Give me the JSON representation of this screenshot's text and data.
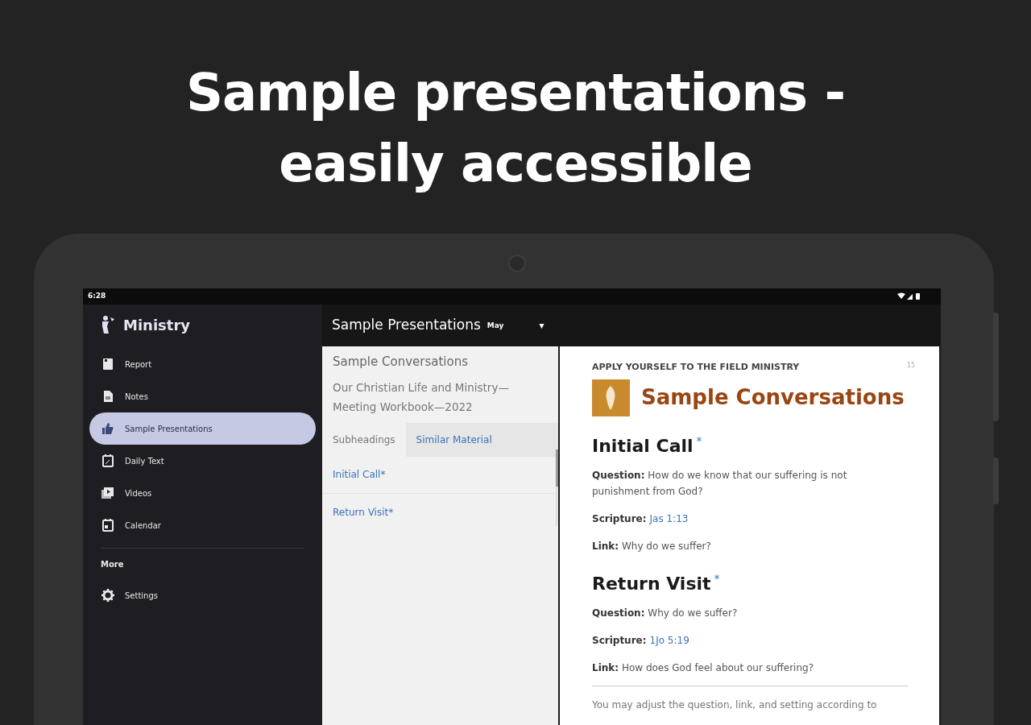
{
  "headline": [
    "Sample presentations -",
    "easily accessible"
  ],
  "status_bar": {
    "time": "6:28"
  },
  "sidebar": {
    "app_name": "Ministry",
    "items": [
      {
        "kind": "nav",
        "label": "Report",
        "selected": false
      },
      {
        "kind": "nav",
        "label": "Notes",
        "selected": false
      },
      {
        "kind": "nav",
        "label": "Sample Presentations",
        "selected": true
      },
      {
        "kind": "nav",
        "label": "Daily Text",
        "selected": false
      },
      {
        "kind": "nav",
        "label": "Videos",
        "selected": false
      },
      {
        "kind": "nav",
        "label": "Calendar",
        "selected": false
      },
      {
        "kind": "divider"
      },
      {
        "kind": "header",
        "label": "More"
      },
      {
        "kind": "nav",
        "label": "Settings",
        "selected": false
      }
    ]
  },
  "toolbar": {
    "title": "Sample Presentations",
    "month": "May",
    "dropdown": "▾"
  },
  "list_panel": {
    "title": "Sample Conversations",
    "source": [
      "Our Christian Life and Ministry—",
      "Meeting Workbook—2022"
    ],
    "tabs": [
      {
        "label": "Subheadings",
        "selected": true
      },
      {
        "label": "Similar Material",
        "selected": false
      }
    ],
    "items": [
      "Initial Call*",
      "Return Visit*"
    ]
  },
  "article": {
    "kicker": "APPLY YOURSELF TO THE FIELD MINISTRY",
    "page_number": "15",
    "title": "Sample Conversations",
    "sections": [
      {
        "heading": "Initial Call",
        "mark": "*",
        "fields": [
          {
            "label": "Question:",
            "value": "How do we know that our suffering is not punishment from God?",
            "kind": "text"
          },
          {
            "label": "Scripture:",
            "value": "Jas 1:13",
            "kind": "link"
          },
          {
            "label": "Link:",
            "value": "Why do we suffer?",
            "kind": "text"
          }
        ]
      },
      {
        "heading": "Return Visit",
        "mark": "*",
        "fields": [
          {
            "label": "Question:",
            "value": "Why do we suffer?",
            "kind": "text"
          },
          {
            "label": "Scripture:",
            "value": "1Jo 5:19",
            "kind": "link"
          },
          {
            "label": "Link:",
            "value": "How does God feel about our suffering?",
            "kind": "text"
          }
        ]
      }
    ],
    "note": "You may adjust the question, link, and setting according to"
  }
}
